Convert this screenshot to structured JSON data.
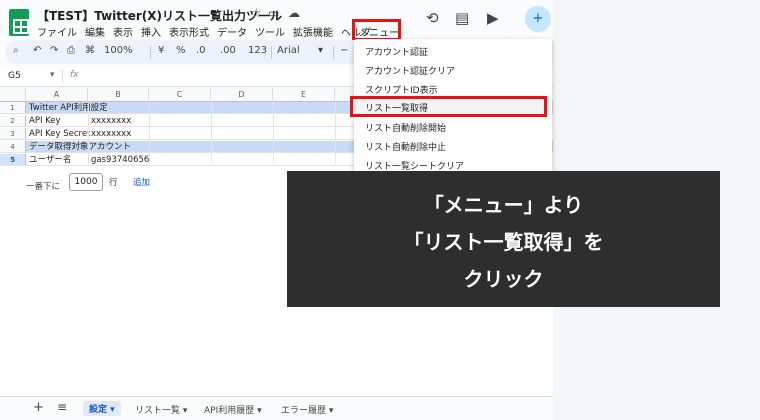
{
  "header": {
    "title": "【TEST】Twitter(X)リスト一覧出力ツール",
    "menu": [
      "ファイル",
      "編集",
      "表示",
      "挿入",
      "表示形式",
      "データ",
      "ツール",
      "拡張機能",
      "ヘルプ"
    ],
    "custom_menu": "メニュー"
  },
  "toolbar": {
    "zoom": "100%",
    "currency": "¥",
    "percent": "%",
    "decimal_less": ".0",
    "decimal_more": ".00",
    "number_format": "123",
    "font": "Arial"
  },
  "formula_bar": {
    "cell_ref": "G5",
    "fx": "fx"
  },
  "columns": [
    "A",
    "B",
    "C",
    "D",
    "E"
  ],
  "rows": [
    {
      "num": "1",
      "a": "Twitter API利用設定",
      "b": ""
    },
    {
      "num": "2",
      "a": "API Key",
      "b": "xxxxxxxx"
    },
    {
      "num": "3",
      "a": "API Key Secret",
      "b": "xxxxxxxx"
    },
    {
      "num": "4",
      "a": "データ取得対象アカウント",
      "b": ""
    },
    {
      "num": "5",
      "a": "ユーザー名",
      "b": "gas93740656"
    }
  ],
  "add_rows": {
    "prefix": "一番下に",
    "count": "1000",
    "unit": "行",
    "link": "追加"
  },
  "dropdown": {
    "items": [
      "アカウント認証",
      "アカウント認証クリア",
      "スクリプトID表示",
      "リスト一覧取得",
      "リスト自動削除開始",
      "リスト自動削除中止",
      "リスト一覧シートクリア"
    ]
  },
  "overlay": {
    "line1": "「メニュー」より",
    "line2": "「リスト一覧取得」を",
    "line3": "クリック"
  },
  "sheet_tabs": [
    "設定",
    "リスト一覧",
    "API利用履歴",
    "エラー履歴"
  ],
  "colors": {
    "highlight_red": "#ee1111",
    "sheets_green": "#0f9d58",
    "header_fill": "#c9daf8"
  }
}
